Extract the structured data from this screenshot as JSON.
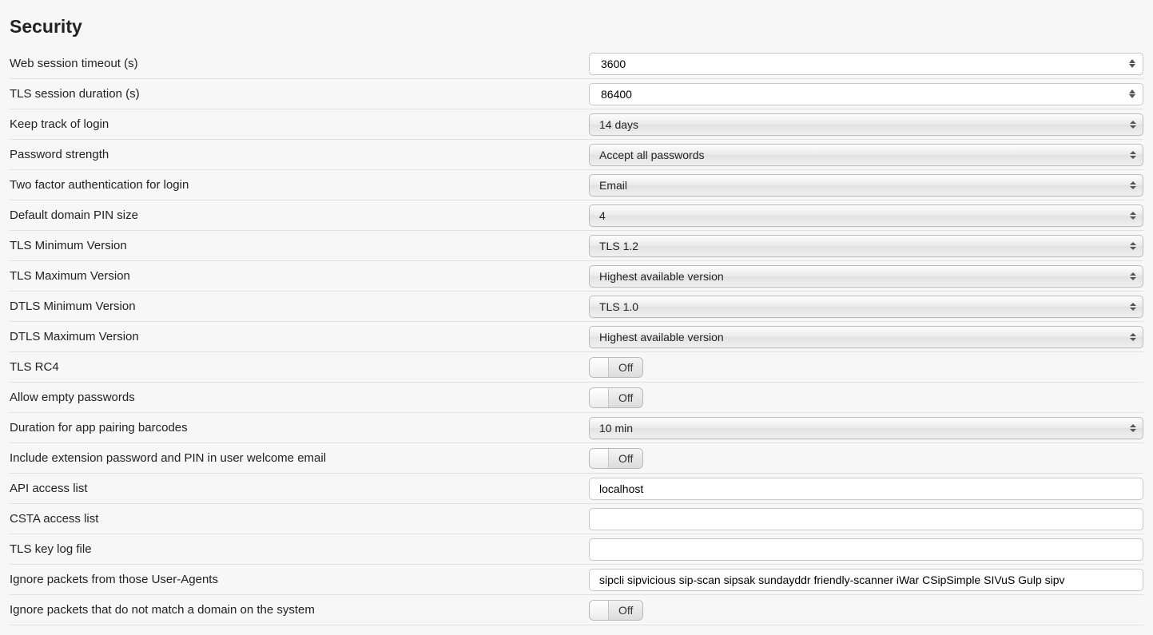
{
  "section_title": "Security",
  "rows": {
    "web_timeout": {
      "label": "Web session timeout (s)",
      "value": "3600"
    },
    "tls_duration": {
      "label": "TLS session duration (s)",
      "value": "86400"
    },
    "keep_login": {
      "label": "Keep track of login",
      "value": "14 days"
    },
    "pw_strength": {
      "label": "Password strength",
      "value": "Accept all passwords"
    },
    "two_factor": {
      "label": "Two factor authentication for login",
      "value": "Email"
    },
    "pin_size": {
      "label": "Default domain PIN size",
      "value": "4"
    },
    "tls_min": {
      "label": "TLS Minimum Version",
      "value": "TLS 1.2"
    },
    "tls_max": {
      "label": "TLS Maximum Version",
      "value": "Highest available version"
    },
    "dtls_min": {
      "label": "DTLS Minimum Version",
      "value": "TLS 1.0"
    },
    "dtls_max": {
      "label": "DTLS Maximum Version",
      "value": "Highest available version"
    },
    "tls_rc4": {
      "label": "TLS RC4",
      "value": "Off"
    },
    "allow_empty_pw": {
      "label": "Allow empty passwords",
      "value": "Off"
    },
    "barcode_duration": {
      "label": "Duration for app pairing barcodes",
      "value": "10 min"
    },
    "include_pw_welcome": {
      "label": "Include extension password and PIN in user welcome email",
      "value": "Off"
    },
    "api_access": {
      "label": "API access list",
      "value": "localhost"
    },
    "csta_access": {
      "label": "CSTA access list",
      "value": ""
    },
    "tls_keylog": {
      "label": "TLS key log file",
      "value": ""
    },
    "ignore_ua": {
      "label": "Ignore packets from those User-Agents",
      "value": "sipcli sipvicious sip-scan sipsak sundayddr friendly-scanner iWar CSipSimple SIVuS Gulp sipv"
    },
    "ignore_nomatch": {
      "label": "Ignore packets that do not match a domain on the system",
      "value": "Off"
    }
  }
}
